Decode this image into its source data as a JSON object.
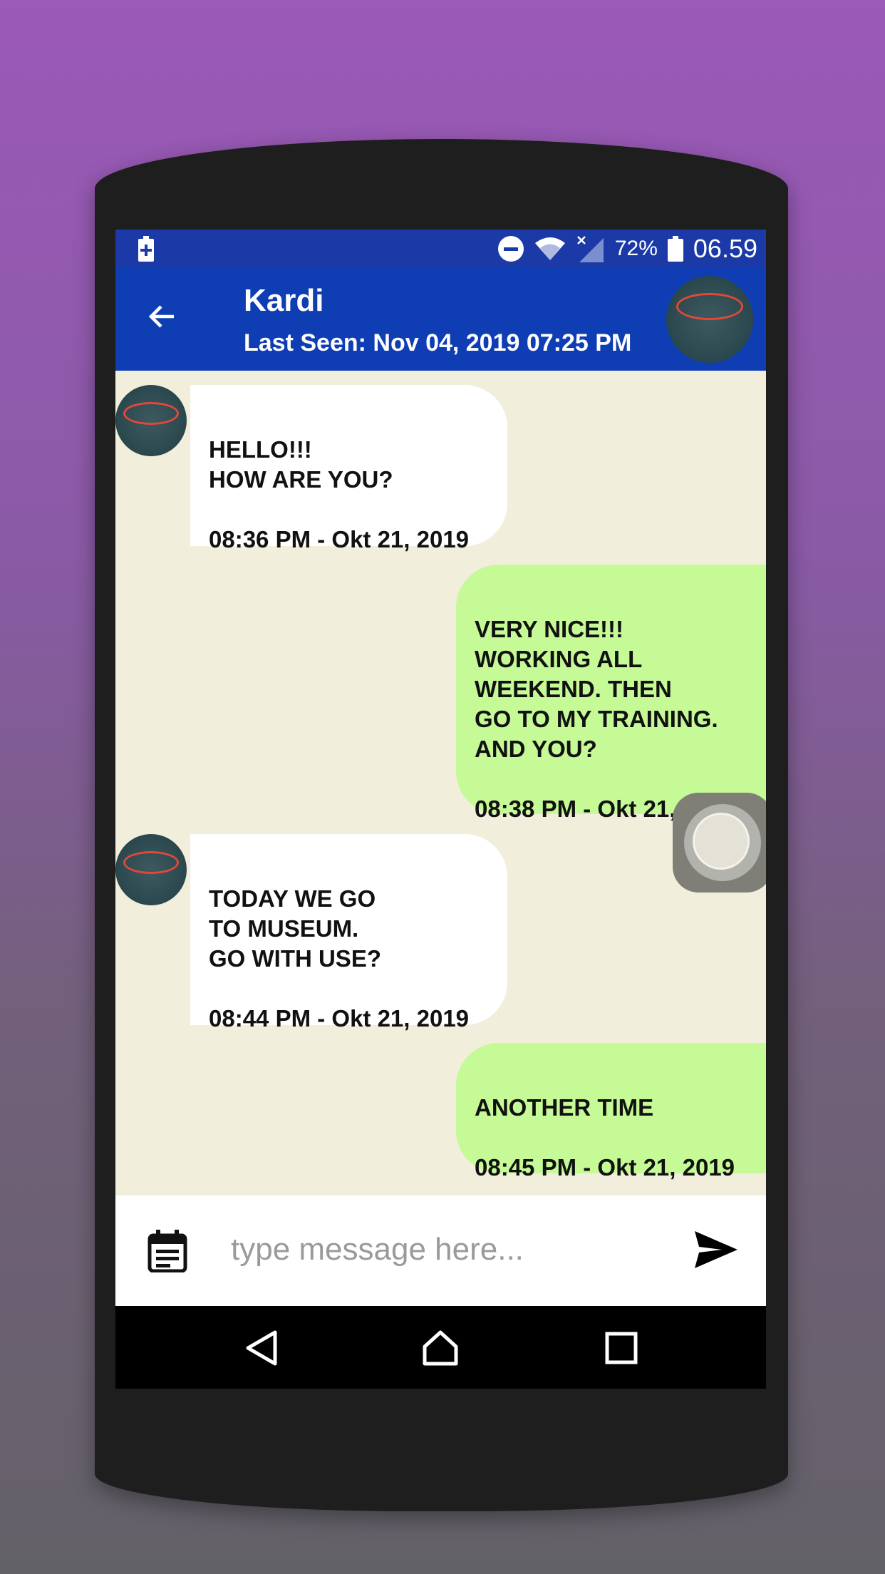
{
  "statusbar": {
    "battery_pct": "72%",
    "time": "06.59"
  },
  "header": {
    "contact_name": "Kardi",
    "last_seen": "Last Seen: Nov 04, 2019 07:25 PM"
  },
  "messages": [
    {
      "direction": "in",
      "text": "HELLO!!!\nHOW ARE YOU?",
      "time": "08:36 PM - Okt 21, 2019"
    },
    {
      "direction": "out",
      "text": "VERY NICE!!!\nWORKING ALL\nWEEKEND. THEN\nGO TO MY TRAINING.\nAND YOU?",
      "time": "08:38 PM - Okt 21, 2019"
    },
    {
      "direction": "in",
      "text": "TODAY WE GO\nTO MUSEUM.\nGO WITH USE?",
      "time": "08:44 PM - Okt 21, 2019"
    },
    {
      "direction": "out",
      "text": "ANOTHER TIME",
      "time": "08:45 PM - Okt 21, 2019"
    }
  ],
  "composer": {
    "placeholder": "type message here..."
  },
  "colors": {
    "appbar": "#0f3db3",
    "statusbar": "#1b3aa8",
    "chat_bg": "#f2eedc",
    "incoming_bubble": "#ffffff",
    "outgoing_bubble": "#c5fa96"
  },
  "icons": [
    "battery-charging-icon",
    "do-not-disturb-icon",
    "wifi-icon",
    "signal-icon",
    "battery-icon",
    "back-arrow-icon",
    "calendar-icon",
    "send-icon",
    "nav-back-icon",
    "nav-home-icon",
    "nav-recents-icon"
  ]
}
